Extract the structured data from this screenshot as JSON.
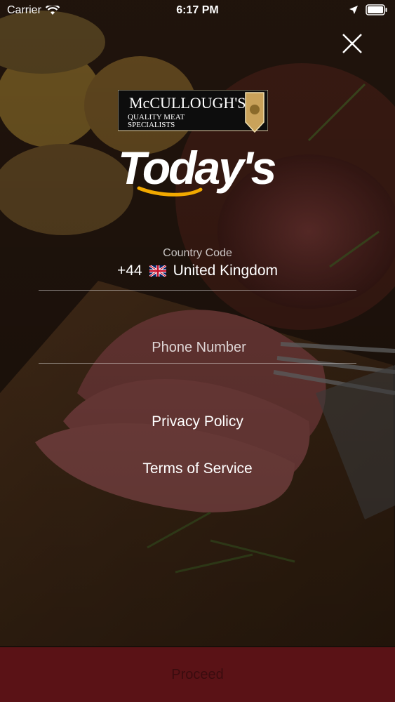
{
  "status_bar": {
    "carrier": "Carrier",
    "time": "6:17 PM"
  },
  "brand": {
    "badge_line1": "McCULLOUGH'S",
    "badge_line2": "QUALITY MEAT",
    "badge_line3": "SPECIALISTS",
    "logo_text": "Today's"
  },
  "country": {
    "label": "Country Code",
    "dial_code": "+44",
    "flag_icon": "uk-flag-icon",
    "name": "United Kingdom"
  },
  "phone": {
    "placeholder": "Phone Number",
    "value": ""
  },
  "links": {
    "privacy": "Privacy Policy",
    "terms": "Terms of Service"
  },
  "proceed": {
    "label": "Proceed"
  },
  "colors": {
    "proceed_bg": "#5a1216",
    "logo_swoosh": "#f2a900",
    "badge_gold": "#c9a25a"
  }
}
